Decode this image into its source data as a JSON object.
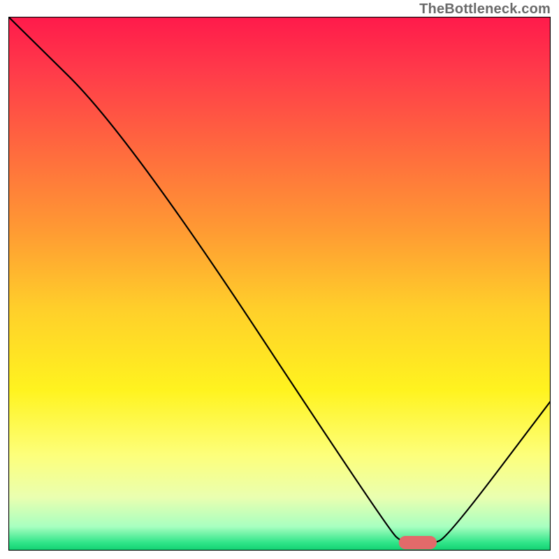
{
  "watermark": "TheBottleneck.com",
  "chart_data": {
    "type": "line",
    "title": "",
    "xlabel": "",
    "ylabel": "",
    "xlim": [
      0,
      100
    ],
    "ylim": [
      0,
      100
    ],
    "grid": false,
    "background_gradient": {
      "stops": [
        {
          "offset": 0.0,
          "color": "#ff1a4b"
        },
        {
          "offset": 0.1,
          "color": "#ff3a4a"
        },
        {
          "offset": 0.25,
          "color": "#ff6a3e"
        },
        {
          "offset": 0.4,
          "color": "#ff9a33"
        },
        {
          "offset": 0.55,
          "color": "#ffd02a"
        },
        {
          "offset": 0.7,
          "color": "#fff31f"
        },
        {
          "offset": 0.82,
          "color": "#fdff7a"
        },
        {
          "offset": 0.9,
          "color": "#eaffb0"
        },
        {
          "offset": 0.955,
          "color": "#a8ffc0"
        },
        {
          "offset": 0.985,
          "color": "#30e589"
        },
        {
          "offset": 1.0,
          "color": "#10d070"
        }
      ]
    },
    "series": [
      {
        "name": "bottleneck-curve",
        "stroke": "#000000",
        "stroke_width": 2.2,
        "points": [
          {
            "x": 0.0,
            "y": 100.0
          },
          {
            "x": 22.0,
            "y": 78.0
          },
          {
            "x": 70.0,
            "y": 4.0
          },
          {
            "x": 73.0,
            "y": 1.2
          },
          {
            "x": 78.0,
            "y": 1.2
          },
          {
            "x": 81.0,
            "y": 2.5
          },
          {
            "x": 100.0,
            "y": 28.0
          }
        ]
      }
    ],
    "marker": {
      "name": "optimal-range-marker",
      "x_center": 75.5,
      "y_center": 1.5,
      "width": 7.0,
      "height": 2.5,
      "rx": 1.25,
      "color": "#e26a6a"
    }
  }
}
